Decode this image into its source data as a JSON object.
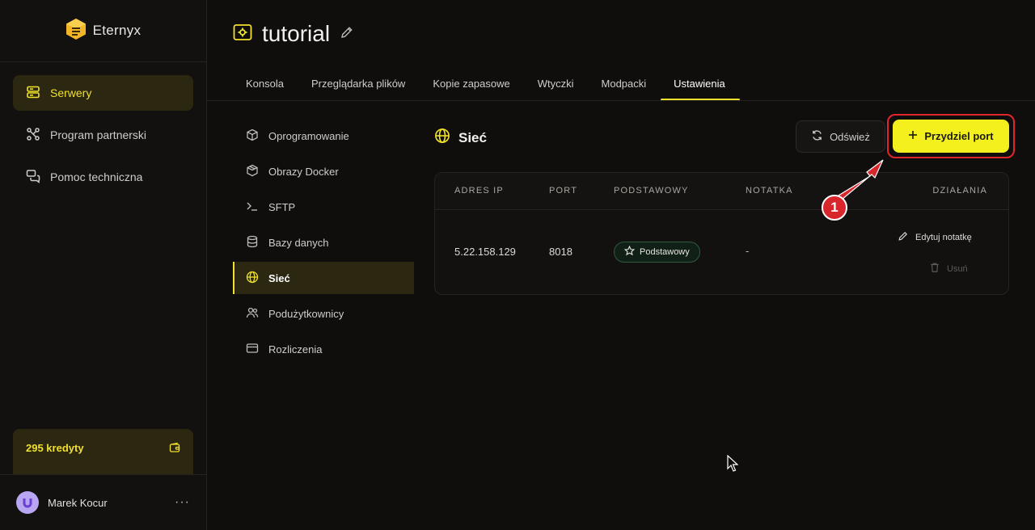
{
  "brand": {
    "name": "Eternyx"
  },
  "sidebar": {
    "items": [
      {
        "label": "Serwery",
        "active": true
      },
      {
        "label": "Program partnerski",
        "active": false
      },
      {
        "label": "Pomoc techniczna",
        "active": false
      }
    ],
    "credits": "295 kredyty",
    "user": {
      "name": "Marek Kocur"
    }
  },
  "header": {
    "title": "tutorial"
  },
  "tabs": [
    {
      "label": "Konsola"
    },
    {
      "label": "Przeglądarka plików"
    },
    {
      "label": "Kopie zapasowe"
    },
    {
      "label": "Wtyczki"
    },
    {
      "label": "Modpacki"
    },
    {
      "label": "Ustawienia",
      "active": true
    }
  ],
  "submenu": [
    {
      "label": "Oprogramowanie"
    },
    {
      "label": "Obrazy Docker"
    },
    {
      "label": "SFTP"
    },
    {
      "label": "Bazy danych"
    },
    {
      "label": "Sieć",
      "active": true
    },
    {
      "label": "Podużytkownicy"
    },
    {
      "label": "Rozliczenia"
    }
  ],
  "section": {
    "title": "Sieć"
  },
  "buttons": {
    "refresh": "Odśwież",
    "assign": "Przydziel port"
  },
  "table": {
    "columns": {
      "ip": "ADRES IP",
      "port": "PORT",
      "primary": "PODSTAWOWY",
      "note": "NOTATKA",
      "actions": "DZIAŁANIA"
    },
    "rows": [
      {
        "ip": "5.22.158.129",
        "port": "8018",
        "primary": "Podstawowy",
        "note": "-",
        "edit": "Edytuj notatkę",
        "delete": "Usuń"
      }
    ]
  },
  "annotation": {
    "number": "1"
  },
  "colors": {
    "accent": "#f1e12a",
    "button": "#f4f01e",
    "highlight": "#e0262b",
    "background": "#0f0e0d"
  }
}
